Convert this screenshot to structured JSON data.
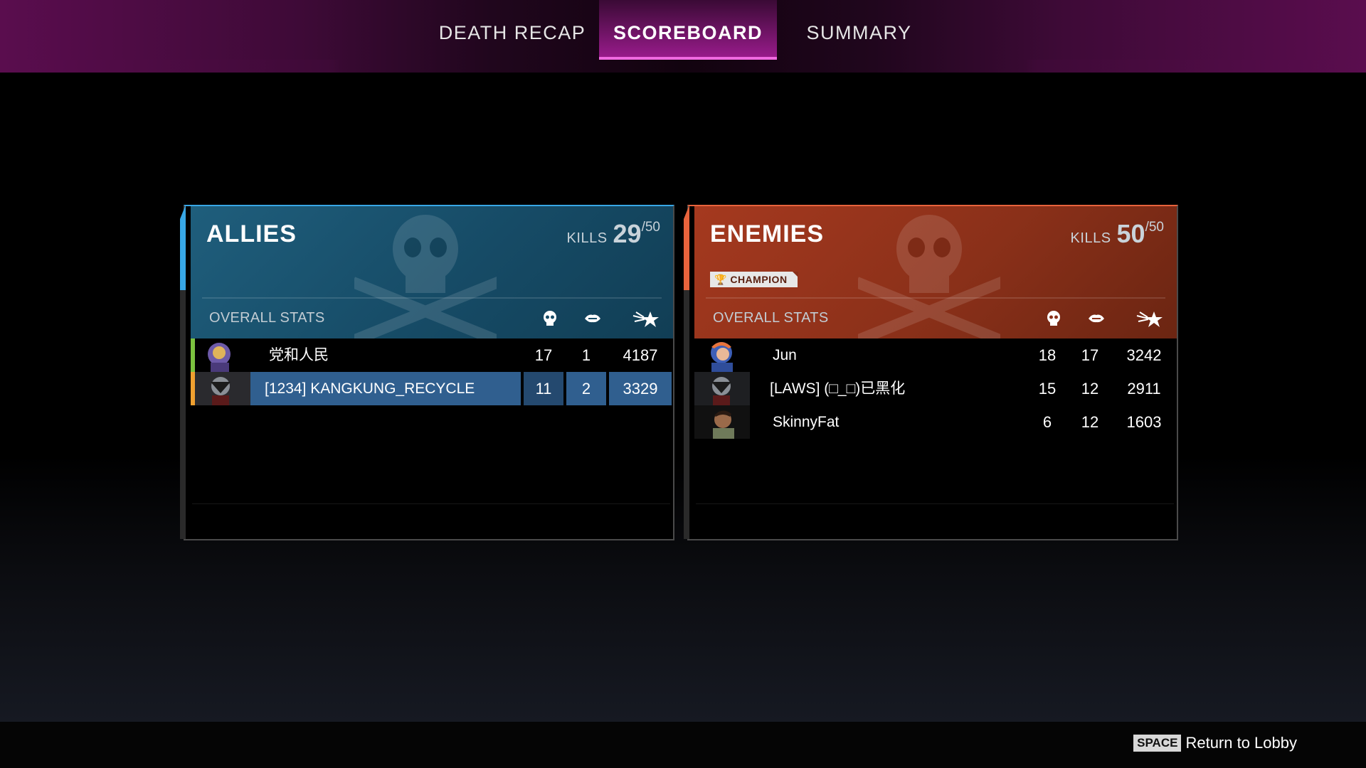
{
  "tabs": [
    {
      "label": "DEATH RECAP",
      "active": false
    },
    {
      "label": "SCOREBOARD",
      "active": true
    },
    {
      "label": "SUMMARY",
      "active": false
    }
  ],
  "allies": {
    "title": "ALLIES",
    "kills_label": "KILLS",
    "kills": "29",
    "kills_max": "/50",
    "overall_stats_label": "OVERALL STATS",
    "accent_color": "#38a7e6",
    "players": [
      {
        "name": "党和人民",
        "kills": "17",
        "assists": "1",
        "damage": "4187",
        "tag_color": "#7cc23f",
        "selected": false
      },
      {
        "name": "[1234] KANGKUNG_RECYCLE",
        "kills": "11",
        "assists": "2",
        "damage": "3329",
        "tag_color": "#f0a030",
        "selected": true
      }
    ]
  },
  "enemies": {
    "title": "ENEMIES",
    "kills_label": "KILLS",
    "kills": "50",
    "kills_max": "/50",
    "badge": "CHAMPION",
    "overall_stats_label": "OVERALL STATS",
    "accent_color": "#e8633c",
    "players": [
      {
        "name": "Jun",
        "kills": "18",
        "assists": "17",
        "damage": "3242"
      },
      {
        "name": "[LAWS] (□_□)已黑化",
        "kills": "15",
        "assists": "12",
        "damage": "2911"
      },
      {
        "name": "SkinnyFat",
        "kills": "6",
        "assists": "12",
        "damage": "1603"
      }
    ]
  },
  "column_icons": [
    "skull-icon",
    "handshake-icon",
    "damage-icon"
  ],
  "footer": {
    "key": "SPACE",
    "action": "Return to Lobby"
  }
}
